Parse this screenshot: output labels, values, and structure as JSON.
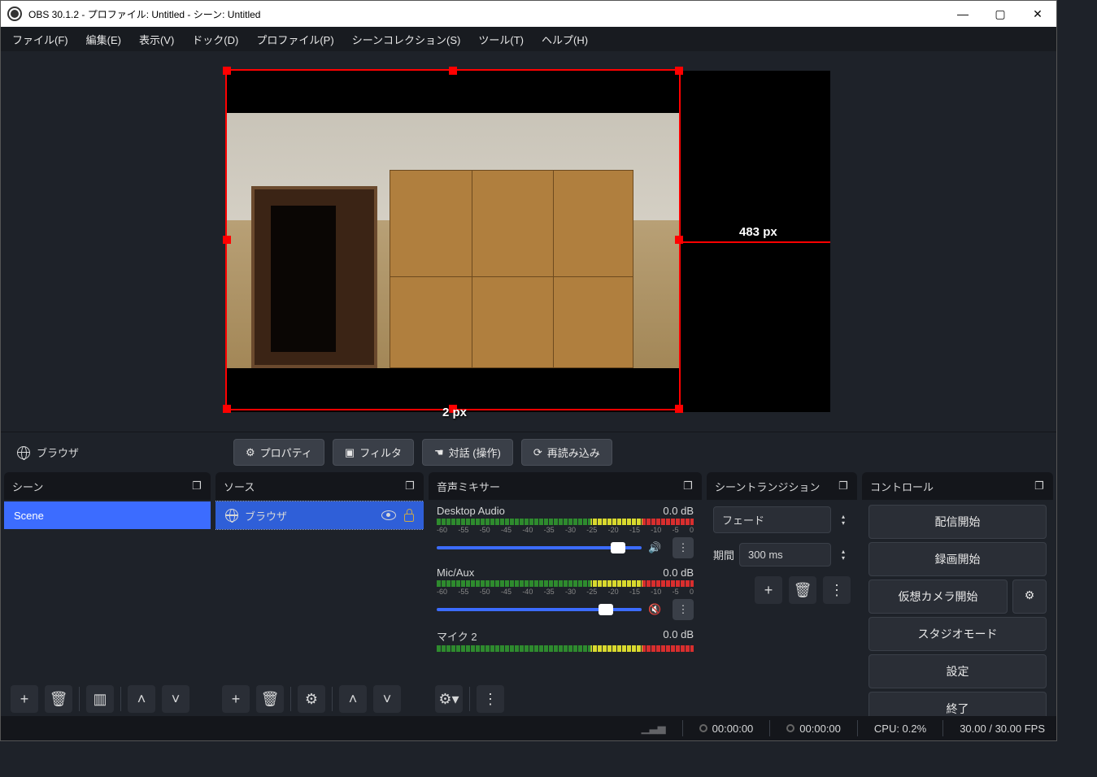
{
  "window": {
    "title": "OBS 30.1.2 - プロファイル: Untitled - シーン: Untitled"
  },
  "menu": {
    "file": "ファイル(F)",
    "edit": "編集(E)",
    "view": "表示(V)",
    "dock": "ドック(D)",
    "profile": "プロファイル(P)",
    "scene_collection": "シーンコレクション(S)",
    "tools": "ツール(T)",
    "help": "ヘルプ(H)"
  },
  "preview": {
    "width_label": "483 px",
    "bottom_label": "2 px"
  },
  "source_toolbar": {
    "selected_source": "ブラウザ",
    "properties": "プロパティ",
    "filters": "フィルタ",
    "interact": "対話 (操作)",
    "refresh": "再読み込み"
  },
  "panels": {
    "scenes": {
      "title": "シーン",
      "items": [
        "Scene"
      ]
    },
    "sources": {
      "title": "ソース",
      "items": [
        "ブラウザ"
      ]
    },
    "mixer": {
      "title": "音声ミキサー",
      "scale": [
        "-60",
        "-55",
        "-50",
        "-45",
        "-40",
        "-35",
        "-30",
        "-25",
        "-20",
        "-15",
        "-10",
        "-5",
        "0"
      ],
      "channels": [
        {
          "name": "Desktop Audio",
          "level": "0.0 dB",
          "muted": false
        },
        {
          "name": "Mic/Aux",
          "level": "0.0 dB",
          "muted": true
        },
        {
          "name": "マイク 2",
          "level": "0.0 dB",
          "muted": false
        }
      ]
    },
    "transitions": {
      "title": "シーントランジション",
      "selected": "フェード",
      "duration_label": "期間",
      "duration_value": "300 ms"
    },
    "controls": {
      "title": "コントロール",
      "start_streaming": "配信開始",
      "start_recording": "録画開始",
      "virtual_camera": "仮想カメラ開始",
      "studio_mode": "スタジオモード",
      "settings": "設定",
      "exit": "終了"
    }
  },
  "status": {
    "live_time": "00:00:00",
    "rec_time": "00:00:00",
    "cpu": "CPU: 0.2%",
    "fps": "30.00 / 30.00 FPS"
  }
}
